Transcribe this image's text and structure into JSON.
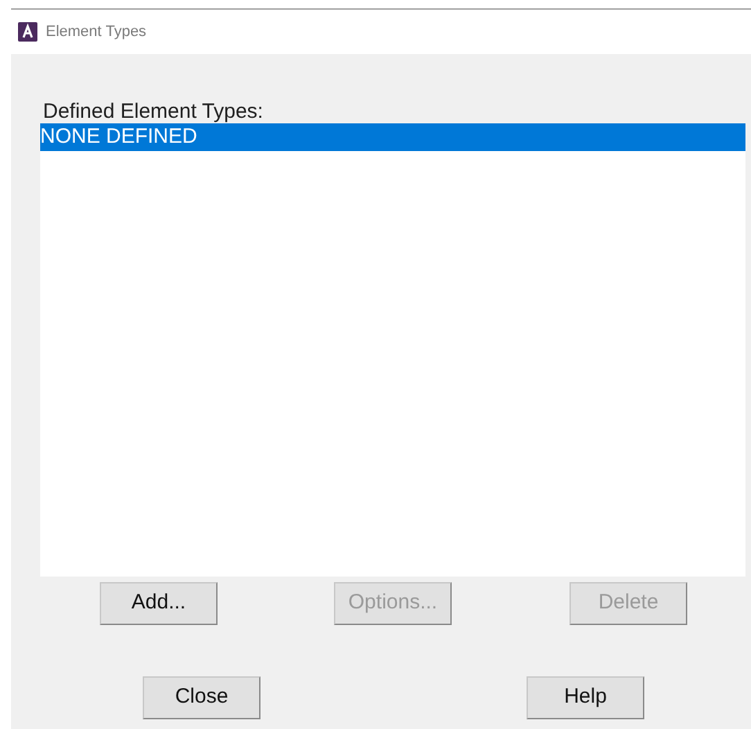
{
  "window": {
    "title": "Element Types"
  },
  "list": {
    "label": "Defined Element Types:",
    "items": [
      {
        "text": "NONE DEFINED",
        "selected": true
      }
    ]
  },
  "action_buttons": [
    {
      "label": "Add...",
      "disabled": false
    },
    {
      "label": "Options...",
      "disabled": true
    },
    {
      "label": "Delete",
      "disabled": true
    }
  ],
  "dialog_buttons": [
    {
      "label": "Close",
      "disabled": false
    },
    {
      "label": "Help",
      "disabled": false
    }
  ]
}
